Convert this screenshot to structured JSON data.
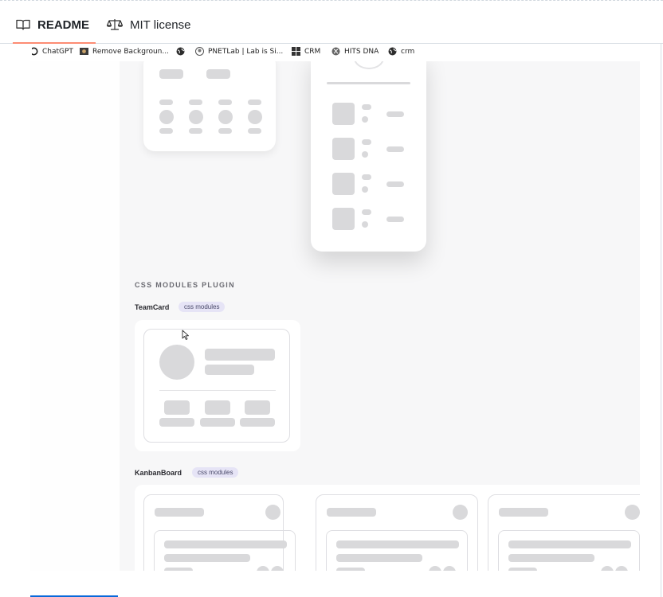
{
  "tabs": [
    {
      "label": "README",
      "icon": "book-icon",
      "active": true
    },
    {
      "label": "MIT license",
      "icon": "scale-icon",
      "active": false
    }
  ],
  "bookmarks": [
    {
      "label": "ChatGPT",
      "icon": "chatgpt-icon"
    },
    {
      "label": "Remove Backgroun...",
      "icon": "image-icon"
    },
    {
      "label": "",
      "icon": "globe-icon"
    },
    {
      "label": "PNETLab | Lab is Si...",
      "icon": "pnetlab-icon"
    },
    {
      "label": "CRM",
      "icon": "grid-icon"
    },
    {
      "label": "HITS DNA",
      "icon": "dna-icon"
    },
    {
      "label": "crm",
      "icon": "globe-icon"
    }
  ],
  "content": {
    "section_title": "CSS MODULES PLUGIN",
    "components": [
      {
        "name": "TeamCard",
        "badge": "css modules"
      },
      {
        "name": "KanbanBoard",
        "badge": "css modules"
      }
    ]
  },
  "colors": {
    "accent_underline": "#fd8c73",
    "placeholder": "#d9d9db",
    "badge_bg": "#e6e4f6"
  }
}
